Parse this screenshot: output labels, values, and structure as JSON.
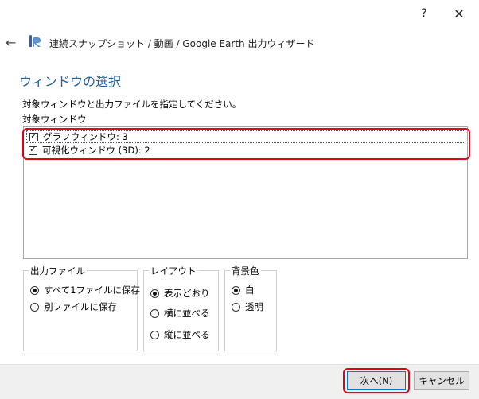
{
  "titlebar": {
    "help_label": "?",
    "close_label": "✕"
  },
  "header": {
    "back_icon": "back-arrow-icon",
    "logo_icon": "app-logo-icon",
    "title": "連続スナップショット / 動画 / Google Earth 出力ウィザード"
  },
  "page": {
    "heading": "ウィンドウの選択",
    "instruction": "対象ウィンドウと出力ファイルを指定してください。",
    "list_label": "対象ウィンドウ",
    "windows": [
      {
        "label": "グラフウィンドウ: 3",
        "checked": true
      },
      {
        "label": "可視化ウィンドウ (3D): 2",
        "checked": true
      }
    ]
  },
  "output_file": {
    "title": "出力ファイル",
    "options": [
      {
        "label": "すべて1ファイルに保存",
        "selected": true
      },
      {
        "label": "別ファイルに保存",
        "selected": false
      }
    ]
  },
  "layout": {
    "title": "レイアウト",
    "options": [
      {
        "label": "表示どおり",
        "selected": true
      },
      {
        "label": "横に並べる",
        "selected": false
      },
      {
        "label": "縦に並べる",
        "selected": false
      }
    ]
  },
  "background": {
    "title": "背景色",
    "options": [
      {
        "label": "白",
        "selected": true
      },
      {
        "label": "透明",
        "selected": false
      }
    ]
  },
  "footer": {
    "next_label": "次へ(N)",
    "cancel_label": "キャンセル"
  },
  "colors": {
    "heading": "#1f5fa8",
    "highlight": "#e60012",
    "focus_border": "#0078d7"
  }
}
